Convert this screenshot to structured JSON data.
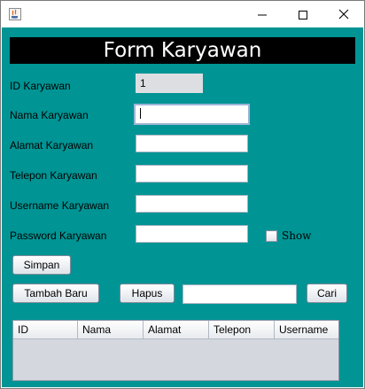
{
  "window": {
    "minimize_glyph": "—",
    "maximize_glyph": "☐",
    "close_glyph": "✕"
  },
  "form": {
    "title": "Form Karyawan",
    "fields": {
      "id": {
        "label": "ID Karyawan",
        "value": "1"
      },
      "nama": {
        "label": "Nama Karyawan",
        "value": ""
      },
      "alamat": {
        "label": "Alamat Karyawan",
        "value": ""
      },
      "telepon": {
        "label": "Telepon Karyawan",
        "value": ""
      },
      "username": {
        "label": "Username Karyawan",
        "value": ""
      },
      "password": {
        "label": "Password Karyawan",
        "value": ""
      }
    },
    "show_checkbox": {
      "label": "Show",
      "checked": false
    },
    "buttons": {
      "simpan": "Simpan",
      "tambah_baru": "Tambah Baru",
      "hapus": "Hapus",
      "cari": "Cari"
    },
    "search": {
      "value": ""
    }
  },
  "table": {
    "columns": [
      "ID",
      "Nama",
      "Alamat",
      "Telepon",
      "Username"
    ],
    "rows": []
  },
  "colors": {
    "background": "#009494",
    "heading_bg": "#000000",
    "heading_text": "#ffffff"
  },
  "icons": {
    "app": "java-app-icon",
    "minimize": "minimize-icon",
    "maximize": "maximize-icon",
    "close": "close-icon"
  }
}
